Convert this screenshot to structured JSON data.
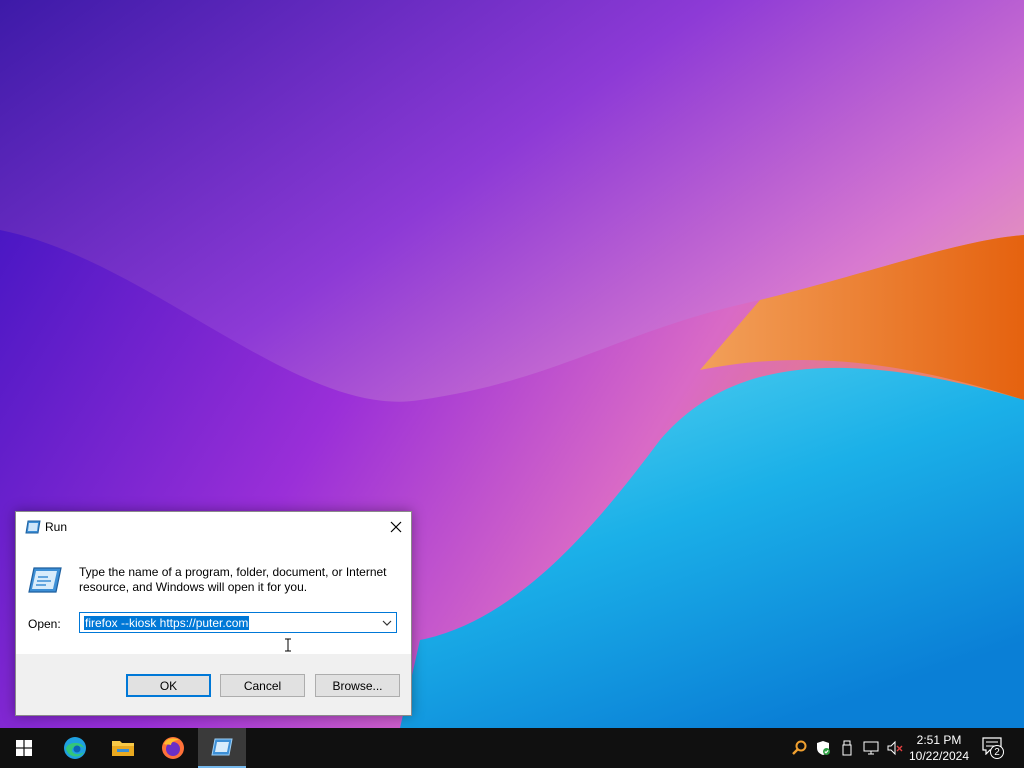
{
  "run_dialog": {
    "title": "Run",
    "description": "Type the name of a program, folder, document, or Internet resource, and Windows will open it for you.",
    "open_label": "Open:",
    "open_value": "firefox --kiosk https://puter.com",
    "ok_label": "OK",
    "cancel_label": "Cancel",
    "browse_label": "Browse..."
  },
  "taskbar": {
    "pinned": [
      {
        "name": "start",
        "icon": "windows-logo-icon"
      },
      {
        "name": "edge",
        "icon": "edge-icon"
      },
      {
        "name": "file-explorer",
        "icon": "folder-icon"
      },
      {
        "name": "firefox",
        "icon": "firefox-icon"
      },
      {
        "name": "run",
        "icon": "run-icon",
        "active": true
      }
    ],
    "tray_icons": [
      "search-tray-icon",
      "security-shield-icon",
      "usb-device-icon",
      "network-icon",
      "volume-muted-icon"
    ],
    "time": "2:51 PM",
    "date": "10/22/2024",
    "notification_count": "2"
  },
  "colors": {
    "accent": "#0078d7",
    "taskbar_bg": "#101010"
  }
}
